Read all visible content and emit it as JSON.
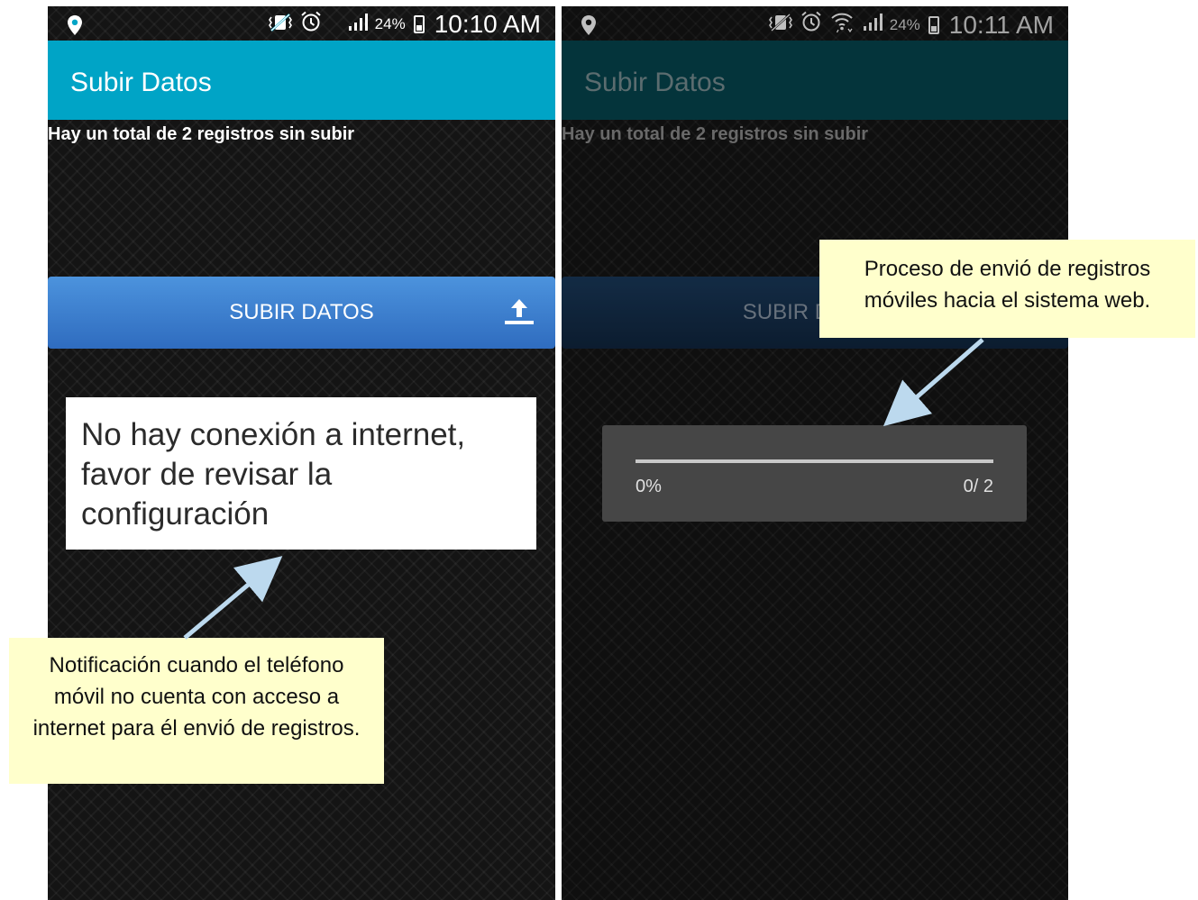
{
  "left_phone": {
    "status": {
      "battery_pct": "24%",
      "time": "10:10 AM"
    },
    "app_title": "Subir Datos",
    "pending_text": "Hay un total de 2 registros sin subir",
    "upload_button": "SUBIR DATOS",
    "toast": "No hay conexión a internet, favor de revisar la configuración"
  },
  "right_phone": {
    "status": {
      "battery_pct": "24%",
      "time": "10:11 AM"
    },
    "app_title": "Subir Datos",
    "pending_text": "Hay un total de 2 registros sin subir",
    "upload_button": "SUBIR DATOS",
    "progress": {
      "percent_label": "0%",
      "count_label": "0/ 2",
      "fraction": 0
    }
  },
  "callouts": {
    "left": "Notificación cuando el teléfono móvil no cuenta con acceso a internet para él envió de registros.",
    "right": "Proceso de envió de registros móviles hacia el sistema web."
  },
  "colors": {
    "app_bar": "#00a4c6",
    "app_bar_dimmed": "#06464f",
    "button": "#3a7fd0",
    "callout_bg": "#ffffcc",
    "arrow": "#bcd9ee"
  },
  "icons": [
    "location-icon",
    "vibrate-icon",
    "alarm-icon",
    "wifi-icon",
    "signal-icon",
    "battery-icon",
    "upload-icon"
  ]
}
